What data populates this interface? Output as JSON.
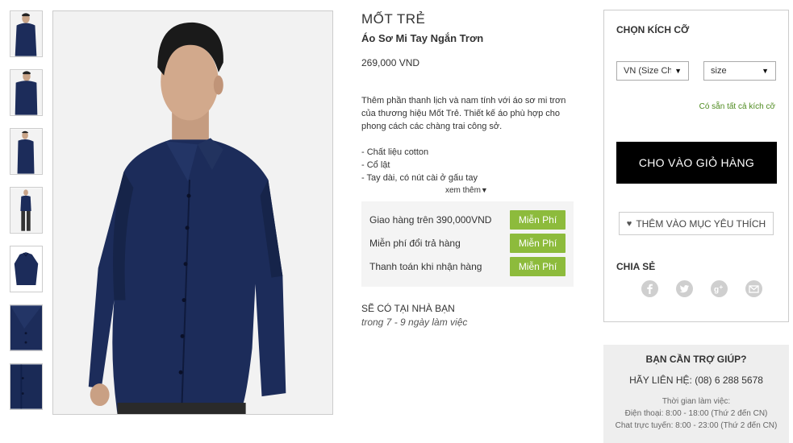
{
  "thumbnails": [
    {
      "alt": "front"
    },
    {
      "alt": "front-closeup"
    },
    {
      "alt": "side"
    },
    {
      "alt": "full-body"
    },
    {
      "alt": "flat"
    },
    {
      "alt": "detail-collar"
    },
    {
      "alt": "detail-fabric"
    }
  ],
  "product": {
    "brand": "MỐT TRẺ",
    "name": "Áo Sơ Mi Tay Ngắn Trơn",
    "price": "269,000 VND",
    "description": "Thêm phần thanh lịch và nam tính với áo sơ mi trơn của thương hiệu Mốt Trẻ. Thiết kế áo phù hợp cho phong cách các chàng trai công sở.",
    "bullets": [
      "- Chất liệu cotton",
      "- Cổ lật",
      "- Tay dài, có nút cài ở gấu tay"
    ],
    "see_more": "xem thêm",
    "shirt_color": "#1c2c5a"
  },
  "perks": [
    {
      "label": "Giao hàng trên 390,000VND",
      "badge": "Miễn Phí"
    },
    {
      "label": "Miễn phí đổi trả hàng",
      "badge": "Miễn Phí"
    },
    {
      "label": "Thanh toán khi nhận hàng",
      "badge": "Miễn Phí"
    }
  ],
  "delivery": {
    "title": "SẼ CÓ TẠI NHÀ BẠN",
    "subtitle": "trong 7 - 9 ngày làm việc"
  },
  "purchase": {
    "size_title": "CHỌN KÍCH CỠ",
    "size_system": "VN (Size Chart)",
    "size_value": "size",
    "size_link": "Có sẵn tất cả kích cỡ",
    "add_to_cart": "CHO VÀO GIỎ HÀNG",
    "wishlist": "THÊM VÀO MỤC YÊU THÍCH",
    "share_title": "CHIA SẺ",
    "socials": [
      "facebook-icon",
      "twitter-icon",
      "google-plus-icon",
      "email-icon"
    ]
  },
  "help": {
    "title": "BẠN CẦN TRỢ GIÚP?",
    "contact": "HÃY LIÊN HỆ: (08) 6 288 5678",
    "hours_title": "Thời gian làm việc:",
    "phone_hours": "Điện thoại: 8:00 - 18:00 (Thứ 2 đến CN)",
    "chat_hours": "Chat trực tuyến: 8:00 - 23:00 (Thứ 2 đến CN)"
  },
  "colors": {
    "accent_green": "#8dbb3c",
    "link_green": "#4d8a1e",
    "cart_button": "#000000"
  }
}
